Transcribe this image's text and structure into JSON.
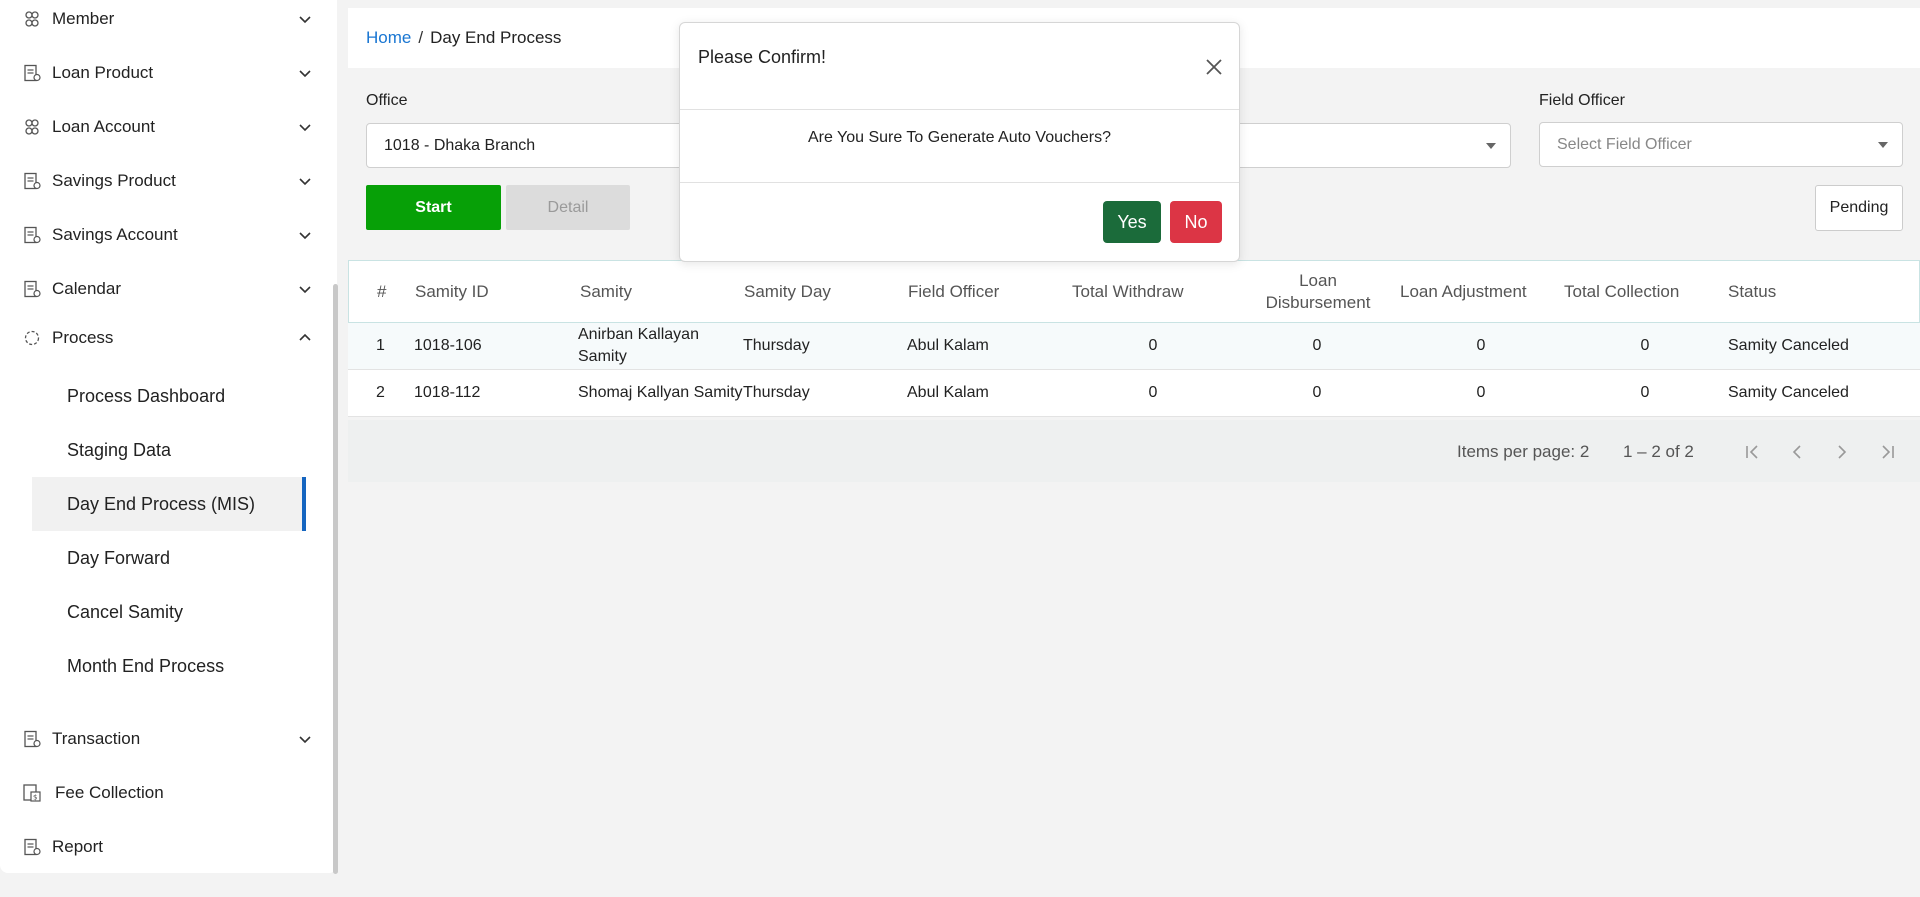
{
  "sidebar": {
    "items": [
      {
        "label": "Member",
        "icon": "member-icon"
      },
      {
        "label": "Loan Product",
        "icon": "document-icon"
      },
      {
        "label": "Loan Account",
        "icon": "member-icon"
      },
      {
        "label": "Savings Product",
        "icon": "document-icon"
      },
      {
        "label": "Savings Account",
        "icon": "document-icon"
      },
      {
        "label": "Calendar",
        "icon": "document-icon"
      },
      {
        "label": "Process",
        "icon": "process-icon"
      }
    ],
    "process_sub": [
      {
        "label": "Process Dashboard"
      },
      {
        "label": "Staging Data"
      },
      {
        "label": "Day End Process (MIS)"
      },
      {
        "label": "Day Forward"
      },
      {
        "label": "Cancel Samity"
      },
      {
        "label": "Month End Process"
      }
    ],
    "bottom_items": [
      {
        "label": "Transaction"
      },
      {
        "label": "Fee Collection"
      },
      {
        "label": "Report"
      }
    ]
  },
  "breadcrumb": {
    "home": "Home",
    "separator": "/",
    "current": "Day End Process"
  },
  "form": {
    "office_label": "Office",
    "office_value": "1018 - Dhaka Branch",
    "field_officer_label": "Field Officer",
    "field_officer_placeholder": "Select Field Officer",
    "start_label": "Start",
    "detail_label": "Detail",
    "pending_label": "Pending"
  },
  "table": {
    "headers": {
      "num": "#",
      "samity_id": "Samity ID",
      "samity": "Samity",
      "samity_day": "Samity Day",
      "field_officer": "Field Officer",
      "total_withdraw": "Total Withdraw",
      "loan_disb_1": "Loan",
      "loan_disb_2": "Disbursement",
      "loan_adjustment": "Loan Adjustment",
      "total_collection": "Total Collection",
      "status": "Status"
    },
    "rows": [
      {
        "num": "1",
        "samity_id": "1018-106",
        "samity_1": "Anirban Kallayan",
        "samity_2": "Samity",
        "samity_day": "Thursday",
        "field_officer": "Abul Kalam",
        "total_withdraw": "0",
        "loan_disbursement": "0",
        "loan_adjustment": "0",
        "total_collection": "0",
        "status": "Samity Canceled"
      },
      {
        "num": "2",
        "samity_id": "1018-112",
        "samity_1": "Shomaj Kallyan Samity",
        "samity_2": "",
        "samity_day": "Thursday",
        "field_officer": "Abul Kalam",
        "total_withdraw": "0",
        "loan_disbursement": "0",
        "loan_adjustment": "0",
        "total_collection": "0",
        "status": "Samity Canceled"
      }
    ]
  },
  "paginator": {
    "items_per_page": "Items per page: 2",
    "range": "1 – 2 of 2"
  },
  "dialog": {
    "title": "Please Confirm!",
    "message": "Are You Sure To Generate Auto Vouchers?",
    "yes_label": "Yes",
    "no_label": "No"
  },
  "colors": {
    "accent_blue": "#1976d2",
    "start_green": "#07a007",
    "yes_green": "#1b6b3a",
    "no_red": "#dc3545",
    "active_border": "#1565c0"
  }
}
